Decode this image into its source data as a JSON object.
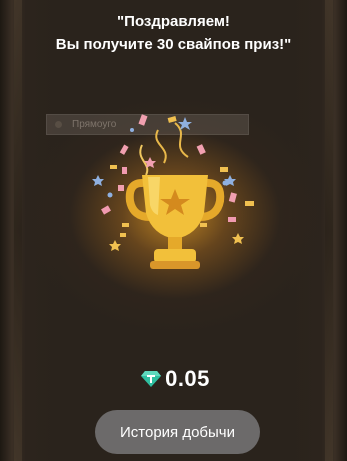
{
  "modal": {
    "title_line1": "\"Поздравляем!",
    "title_line2": "Вы получите 30 свайпов приз!\""
  },
  "background_overlay": {
    "field_text": "Прямоуго"
  },
  "reward": {
    "icon": "tether-gem-icon",
    "amount": "0.05",
    "gem_color": "#2fbfa0"
  },
  "actions": {
    "history_button_label": "История добычи"
  },
  "colors": {
    "glow": "#d69424",
    "trophy": "#f2c03a",
    "button_bg": "#6c6a6a"
  }
}
